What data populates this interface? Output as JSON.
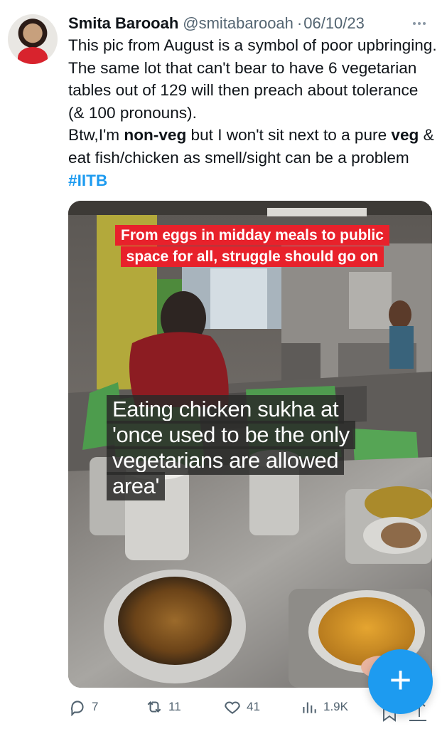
{
  "user": {
    "display_name": "Smita Barooah",
    "handle": "@smitabarooah",
    "separator": "·",
    "date": "06/10/23"
  },
  "tweet": {
    "text_part1": "This pic from August is a symbol of poor upbringing. The same lot that can't bear to have 6 vegetarian tables out of 129 will then preach about tolerance (& 100 pronouns).\nBtw,I'm ",
    "bold1": "non-veg",
    "text_part2": " but I won't sit next to a pure ",
    "bold2": "veg",
    "text_part3": " & eat fish/chicken as smell/sight can be a problem ",
    "hashtag": "#IITB"
  },
  "media": {
    "red_caption": "From eggs in midday meals to public space for all, struggle should go on",
    "dark_caption": "Eating chicken sukha at 'once used to be the only vegetarians are allowed area'"
  },
  "actions": {
    "replies": "7",
    "reposts": "11",
    "likes": "41",
    "views": "1.9K"
  },
  "icons": {
    "more": "more-horizontal-icon",
    "reply": "reply-icon",
    "repost": "repost-icon",
    "like": "heart-icon",
    "views": "views-icon",
    "compose": "compose-plus-icon"
  },
  "colors": {
    "accent": "#1d9bf0",
    "text_secondary": "#536471",
    "caption_red": "#e8212b"
  }
}
